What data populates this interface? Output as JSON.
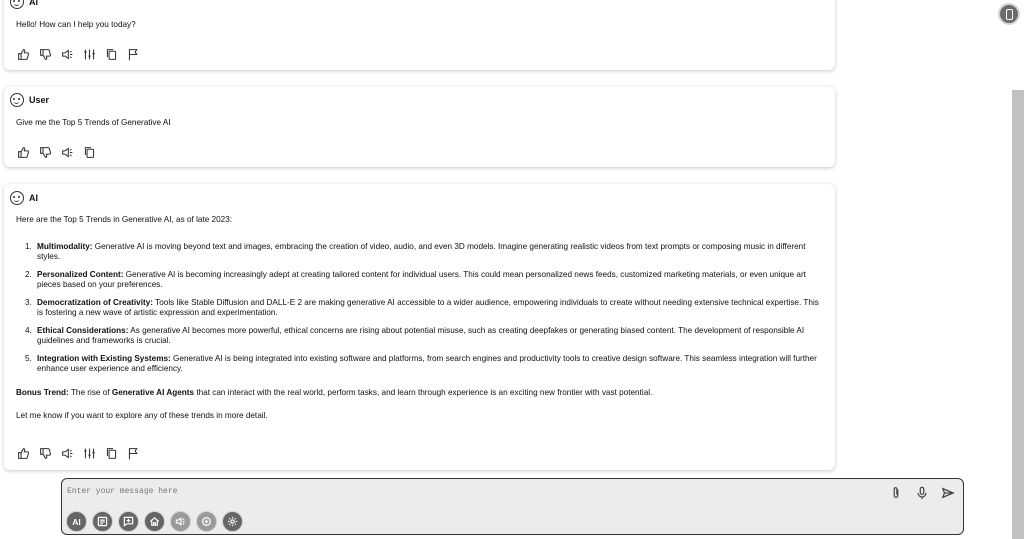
{
  "messages": [
    {
      "role": "AI",
      "text": "Hello! How can I help you today?"
    },
    {
      "role": "User",
      "text": "Give me the Top 5 Trends of Generative AI"
    },
    {
      "role": "AI",
      "intro": "Here are the Top 5 Trends in Generative AI, as of late 2023:",
      "trends": [
        {
          "num": "1.",
          "title": "Multimodality:",
          "text": " Generative AI is moving beyond text and images, embracing the creation of video, audio, and even 3D models. Imagine generating realistic videos from text prompts or composing music in different styles."
        },
        {
          "num": "2.",
          "title": "Personalized Content:",
          "text": " Generative AI is becoming increasingly adept at creating tailored content for individual users. This could mean personalized news feeds, customized marketing materials, or even unique art pieces based on your preferences."
        },
        {
          "num": "3.",
          "title": "Democratization of Creativity:",
          "text": " Tools like Stable Diffusion and DALL-E 2 are making generative AI accessible to a wider audience, empowering individuals to create without needing extensive technical expertise. This is fostering a new wave of artistic expression and experimentation."
        },
        {
          "num": "4.",
          "title": "Ethical Considerations:",
          "text": " As generative AI becomes more powerful, ethical concerns are rising about potential misuse, such as creating deepfakes or generating biased content. The development of responsible AI guidelines and frameworks is crucial."
        },
        {
          "num": "5.",
          "title": "Integration with Existing Systems:",
          "text": " Generative AI is being integrated into existing software and platforms, from search engines and productivity tools to creative design software. This seamless integration will further enhance user experience and efficiency."
        }
      ],
      "bonus_label": "Bonus Trend:",
      "bonus_pre": " The rise of ",
      "bonus_bold": "Generative AI Agents",
      "bonus_post": " that can interact with the real world, perform tasks, and learn through experience is an exciting new frontier with vast potential.",
      "outro": "Let me know if you want to explore any of these trends in more detail."
    }
  ],
  "composer": {
    "placeholder": "Enter your message here",
    "ai_button_label": "AI"
  },
  "icons": {
    "ai_actions": [
      "thumbs-up-icon",
      "thumbs-down-icon",
      "speaker-icon",
      "sliders-icon",
      "copy-icon",
      "flag-icon"
    ],
    "user_actions": [
      "thumbs-up-icon",
      "thumbs-down-icon",
      "speaker-icon",
      "copy-icon"
    ],
    "composer_right": [
      "paperclip-icon",
      "microphone-icon",
      "send-icon"
    ],
    "toolbar": [
      "ai-icon",
      "notes-icon",
      "new-chat-icon",
      "home-icon",
      "speaker-icon",
      "voice-chat-icon",
      "settings-icon"
    ]
  },
  "colors": {
    "tool_button": "#666666",
    "tool_button_dim": "#9a9a9a",
    "composer_bg": "#ececec"
  }
}
